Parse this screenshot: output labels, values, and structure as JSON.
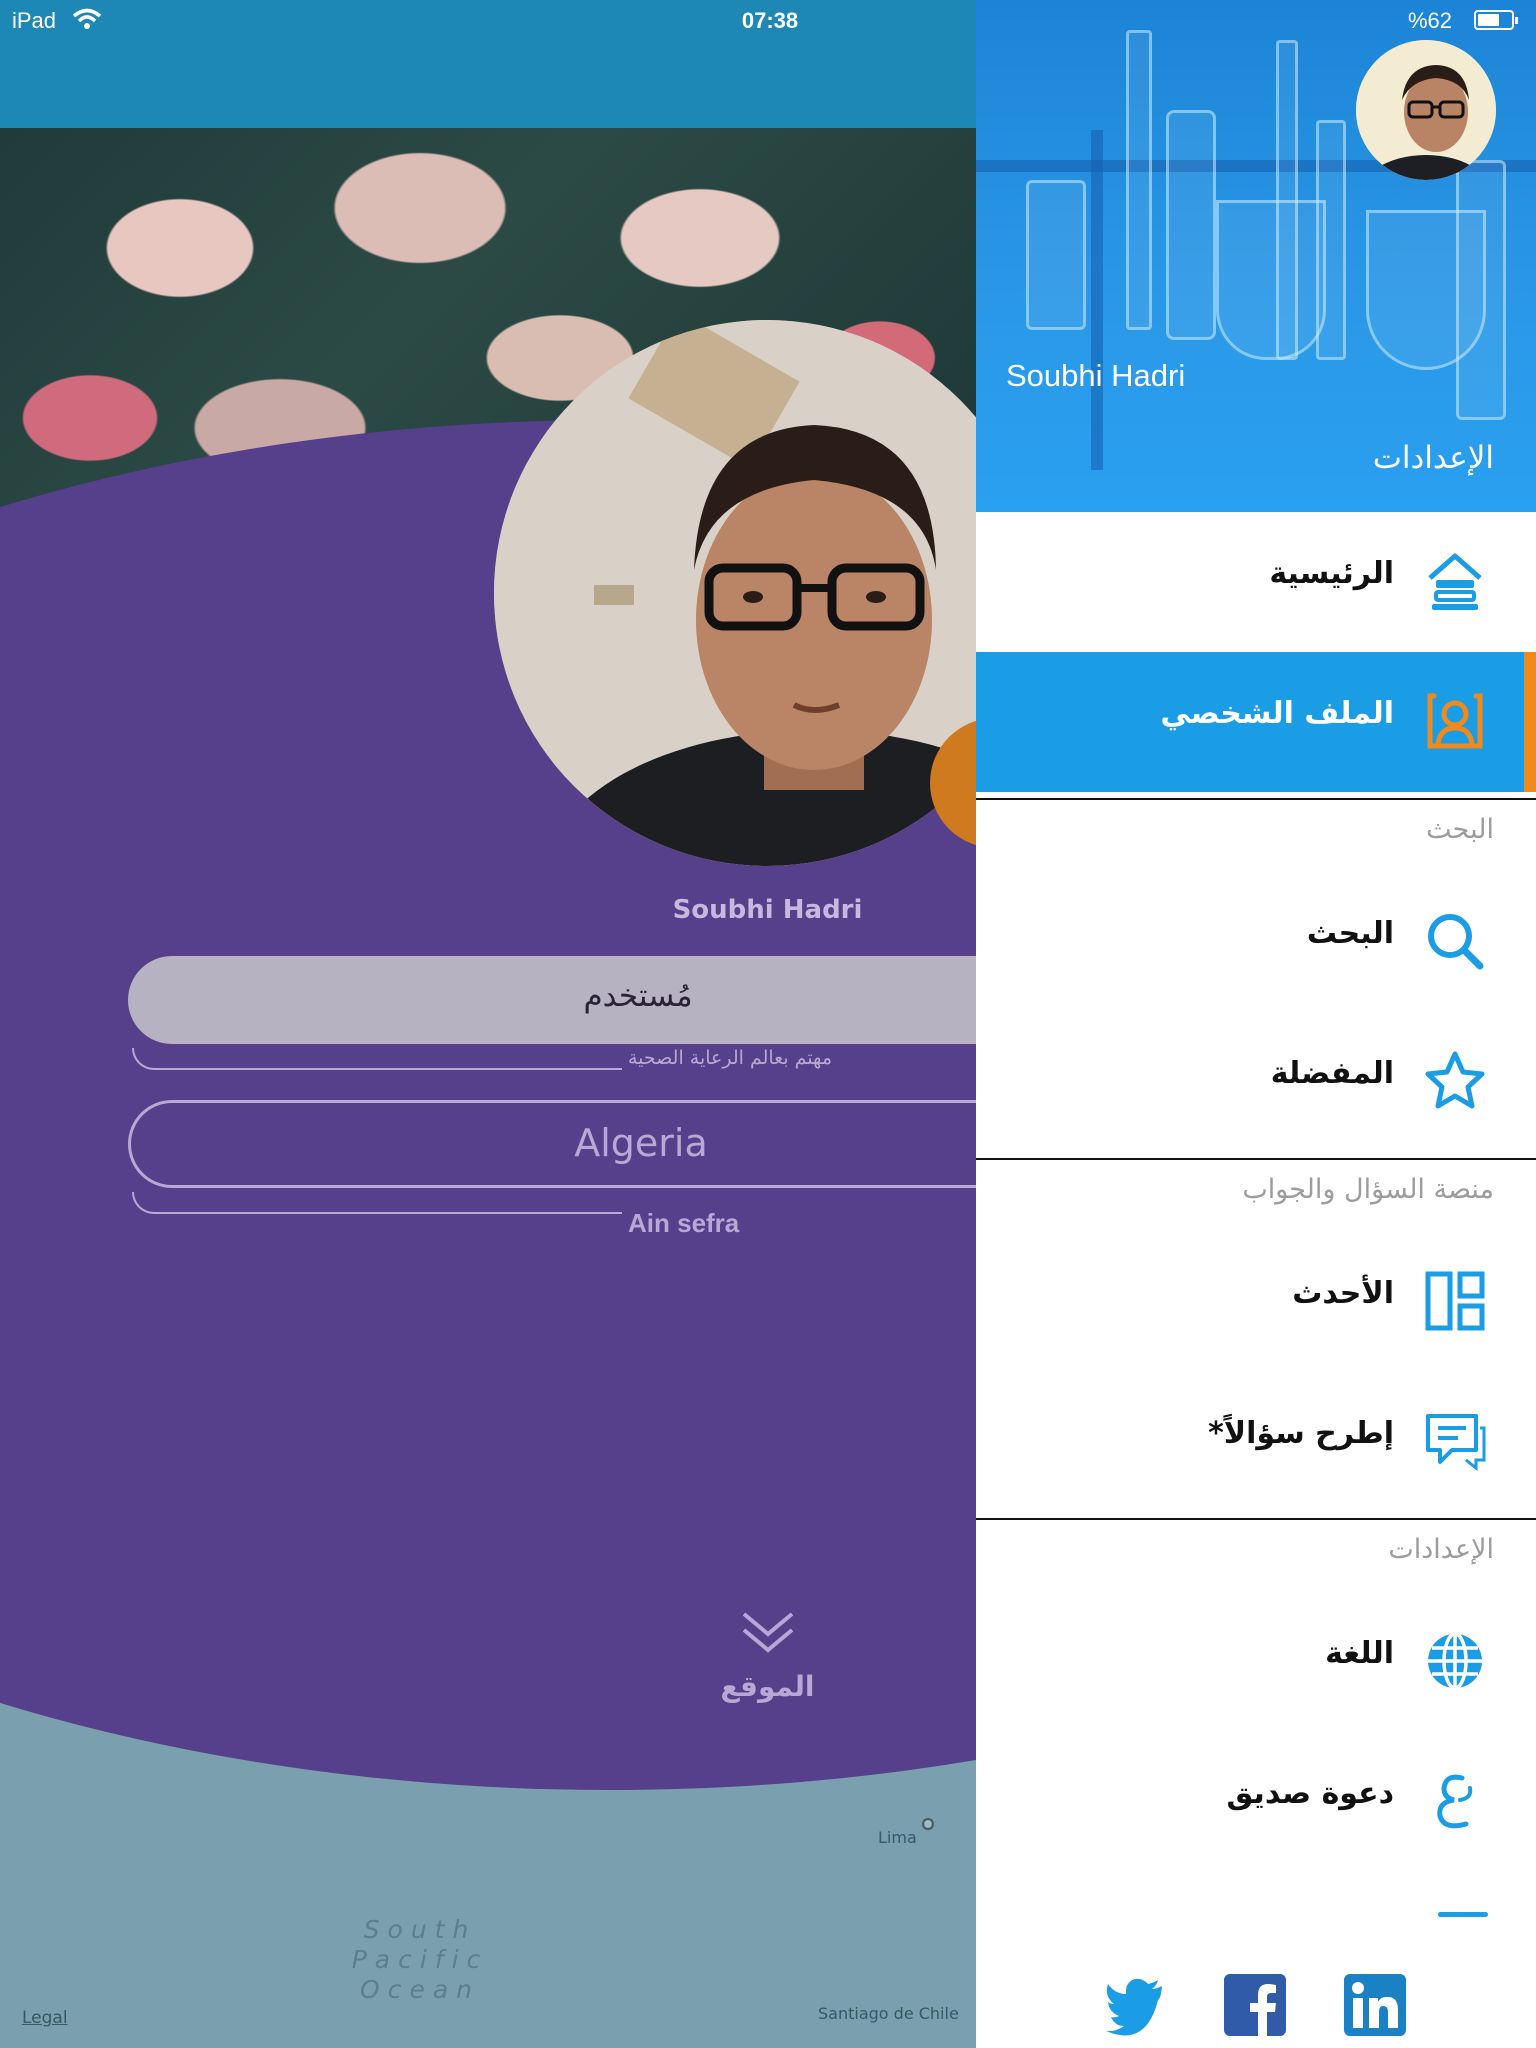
{
  "status_bar": {
    "carrier": "iPad",
    "time": "07:38",
    "battery": "%62",
    "battery_level": 0.62
  },
  "profile": {
    "name": "Soubhi Hadri",
    "role": "مُستخدم",
    "bio": "مهتم بعالم الرعاية الصحية",
    "country": "Algeria",
    "city": "Ain sefra",
    "location_label": "الموقع",
    "map": {
      "ocean": "South Pacific\nOcean",
      "city_lima": "Lima",
      "city_santiago": "Santiago de Chile",
      "legal": "Legal"
    }
  },
  "drawer": {
    "user_name": "Soubhi Hadri",
    "settings_link": "الإعدادات",
    "items": [
      {
        "label": "الرئيسية",
        "icon": "home-icon"
      },
      {
        "label": "الملف الشخصي",
        "icon": "profile-icon",
        "active": true
      }
    ],
    "sections": [
      {
        "title": "البحث",
        "items": [
          {
            "label": "البحث",
            "icon": "search-icon"
          },
          {
            "label": "المفضلة",
            "icon": "star-icon"
          }
        ]
      },
      {
        "title": "منصة السؤال والجواب",
        "items": [
          {
            "label": "الأحدث",
            "icon": "layout-icon"
          },
          {
            "label": "*إطرح سؤالاً",
            "icon": "chat-icon"
          }
        ]
      },
      {
        "title": "الإعدادات",
        "items": [
          {
            "label": "اللغة",
            "icon": "globe-icon"
          },
          {
            "label": "دعوة صديق",
            "icon": "invite-icon"
          }
        ]
      }
    ],
    "social": [
      "twitter-icon",
      "facebook-icon",
      "linkedin-icon"
    ]
  },
  "colors": {
    "accent": "#1a9de4",
    "active_bar": "#f08a1c",
    "purple": "#563f8b",
    "navbar": "#1d88b5"
  }
}
